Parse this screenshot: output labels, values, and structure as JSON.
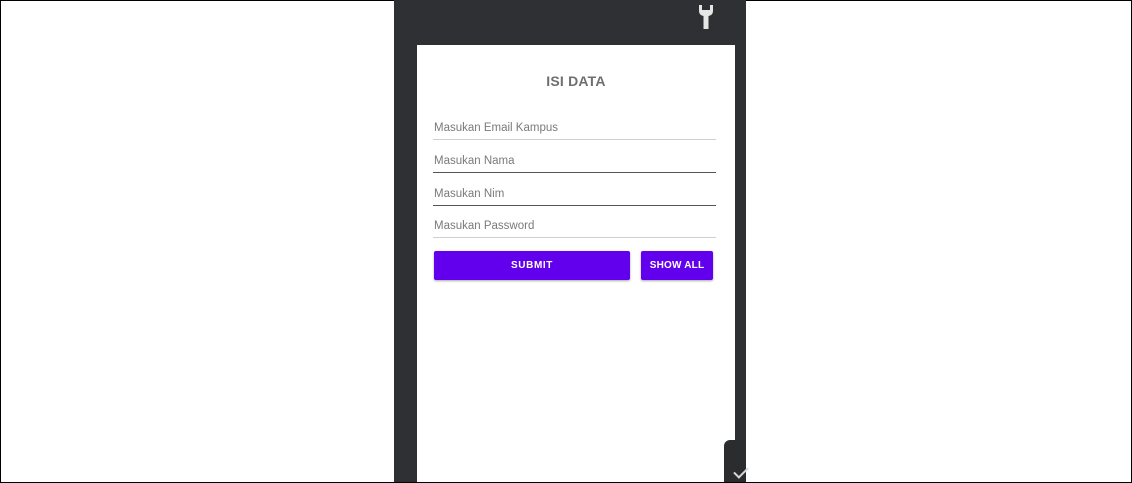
{
  "form": {
    "title": "ISI DATA",
    "email_placeholder": "Masukan Email Kampus",
    "name_placeholder": "Masukan Nama",
    "nim_placeholder": "Masukan Nim",
    "password_placeholder": "Masukan Password",
    "submit_label": "SUBMIT",
    "show_all_label": "SHOW ALL"
  },
  "icons": {
    "top_right": "wrench-icon",
    "side_handle": "checkmark-icon"
  },
  "colors": {
    "primary": "#6200ee",
    "frame": "#2f3033"
  }
}
